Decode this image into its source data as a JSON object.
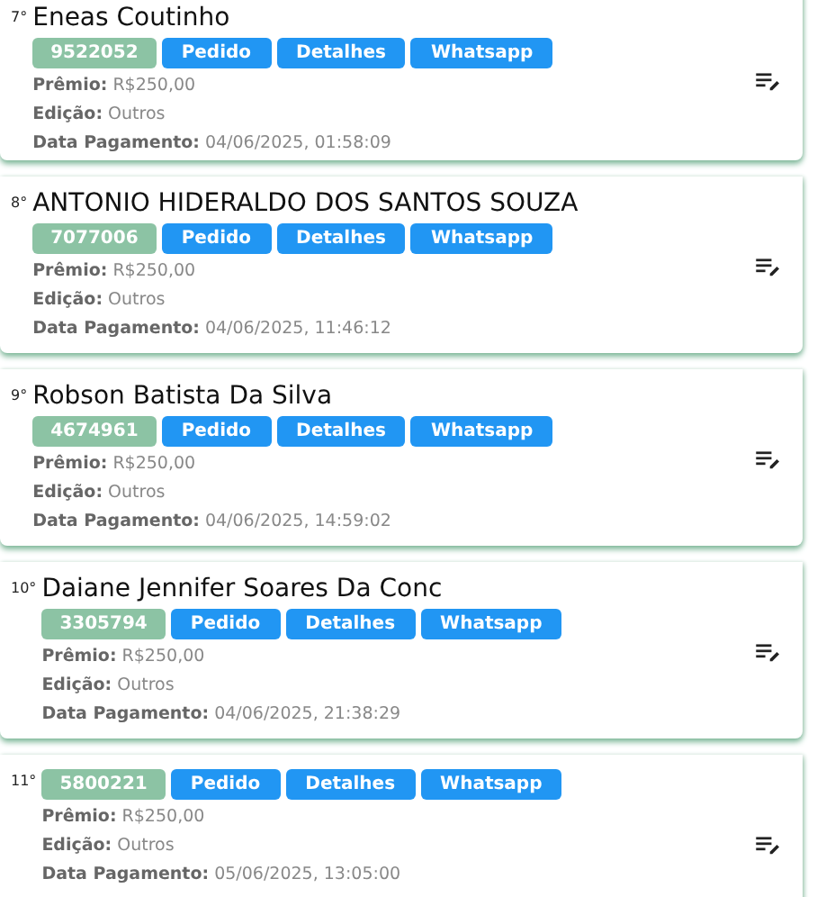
{
  "entries": [
    {
      "rank": "7°",
      "name": "Eneas Coutinho",
      "code": "9522052",
      "buttons": [
        "Pedido",
        "Detalhes",
        "Whatsapp"
      ],
      "details": [
        {
          "label": "Prêmio:",
          "value": "R$250,00"
        },
        {
          "label": "Edição:",
          "value": "Outros"
        },
        {
          "label": "Data Pagamento:",
          "value": "04/06/2025, 01:58:09"
        }
      ]
    },
    {
      "rank": "8°",
      "name": "ANTONIO HIDERALDO DOS SANTOS SOUZA",
      "code": "7077006",
      "buttons": [
        "Pedido",
        "Detalhes",
        "Whatsapp"
      ],
      "details": [
        {
          "label": "Prêmio:",
          "value": "R$250,00"
        },
        {
          "label": "Edição:",
          "value": "Outros"
        },
        {
          "label": "Data Pagamento:",
          "value": "04/06/2025, 11:46:12"
        }
      ]
    },
    {
      "rank": "9°",
      "name": "Robson Batista Da Silva",
      "code": "4674961",
      "buttons": [
        "Pedido",
        "Detalhes",
        "Whatsapp"
      ],
      "details": [
        {
          "label": "Prêmio:",
          "value": "R$250,00"
        },
        {
          "label": "Edição:",
          "value": "Outros"
        },
        {
          "label": "Data Pagamento:",
          "value": "04/06/2025, 14:59:02"
        }
      ]
    },
    {
      "rank": "10°",
      "name": "Daiane Jennifer Soares Da Conc",
      "code": "3305794",
      "buttons": [
        "Pedido",
        "Detalhes",
        "Whatsapp"
      ],
      "details": [
        {
          "label": "Prêmio:",
          "value": "R$250,00"
        },
        {
          "label": "Edição:",
          "value": "Outros"
        },
        {
          "label": "Data Pagamento:",
          "value": "04/06/2025, 21:38:29"
        }
      ]
    },
    {
      "rank": "11°",
      "code": "5800221",
      "buttons": [
        "Pedido",
        "Detalhes",
        "Whatsapp"
      ],
      "details": [
        {
          "label": "Prêmio:",
          "value": "R$250,00"
        },
        {
          "label": "Edição:",
          "value": "Outros"
        },
        {
          "label": "Data Pagamento:",
          "value": "05/06/2025, 13:05:00"
        }
      ]
    }
  ]
}
